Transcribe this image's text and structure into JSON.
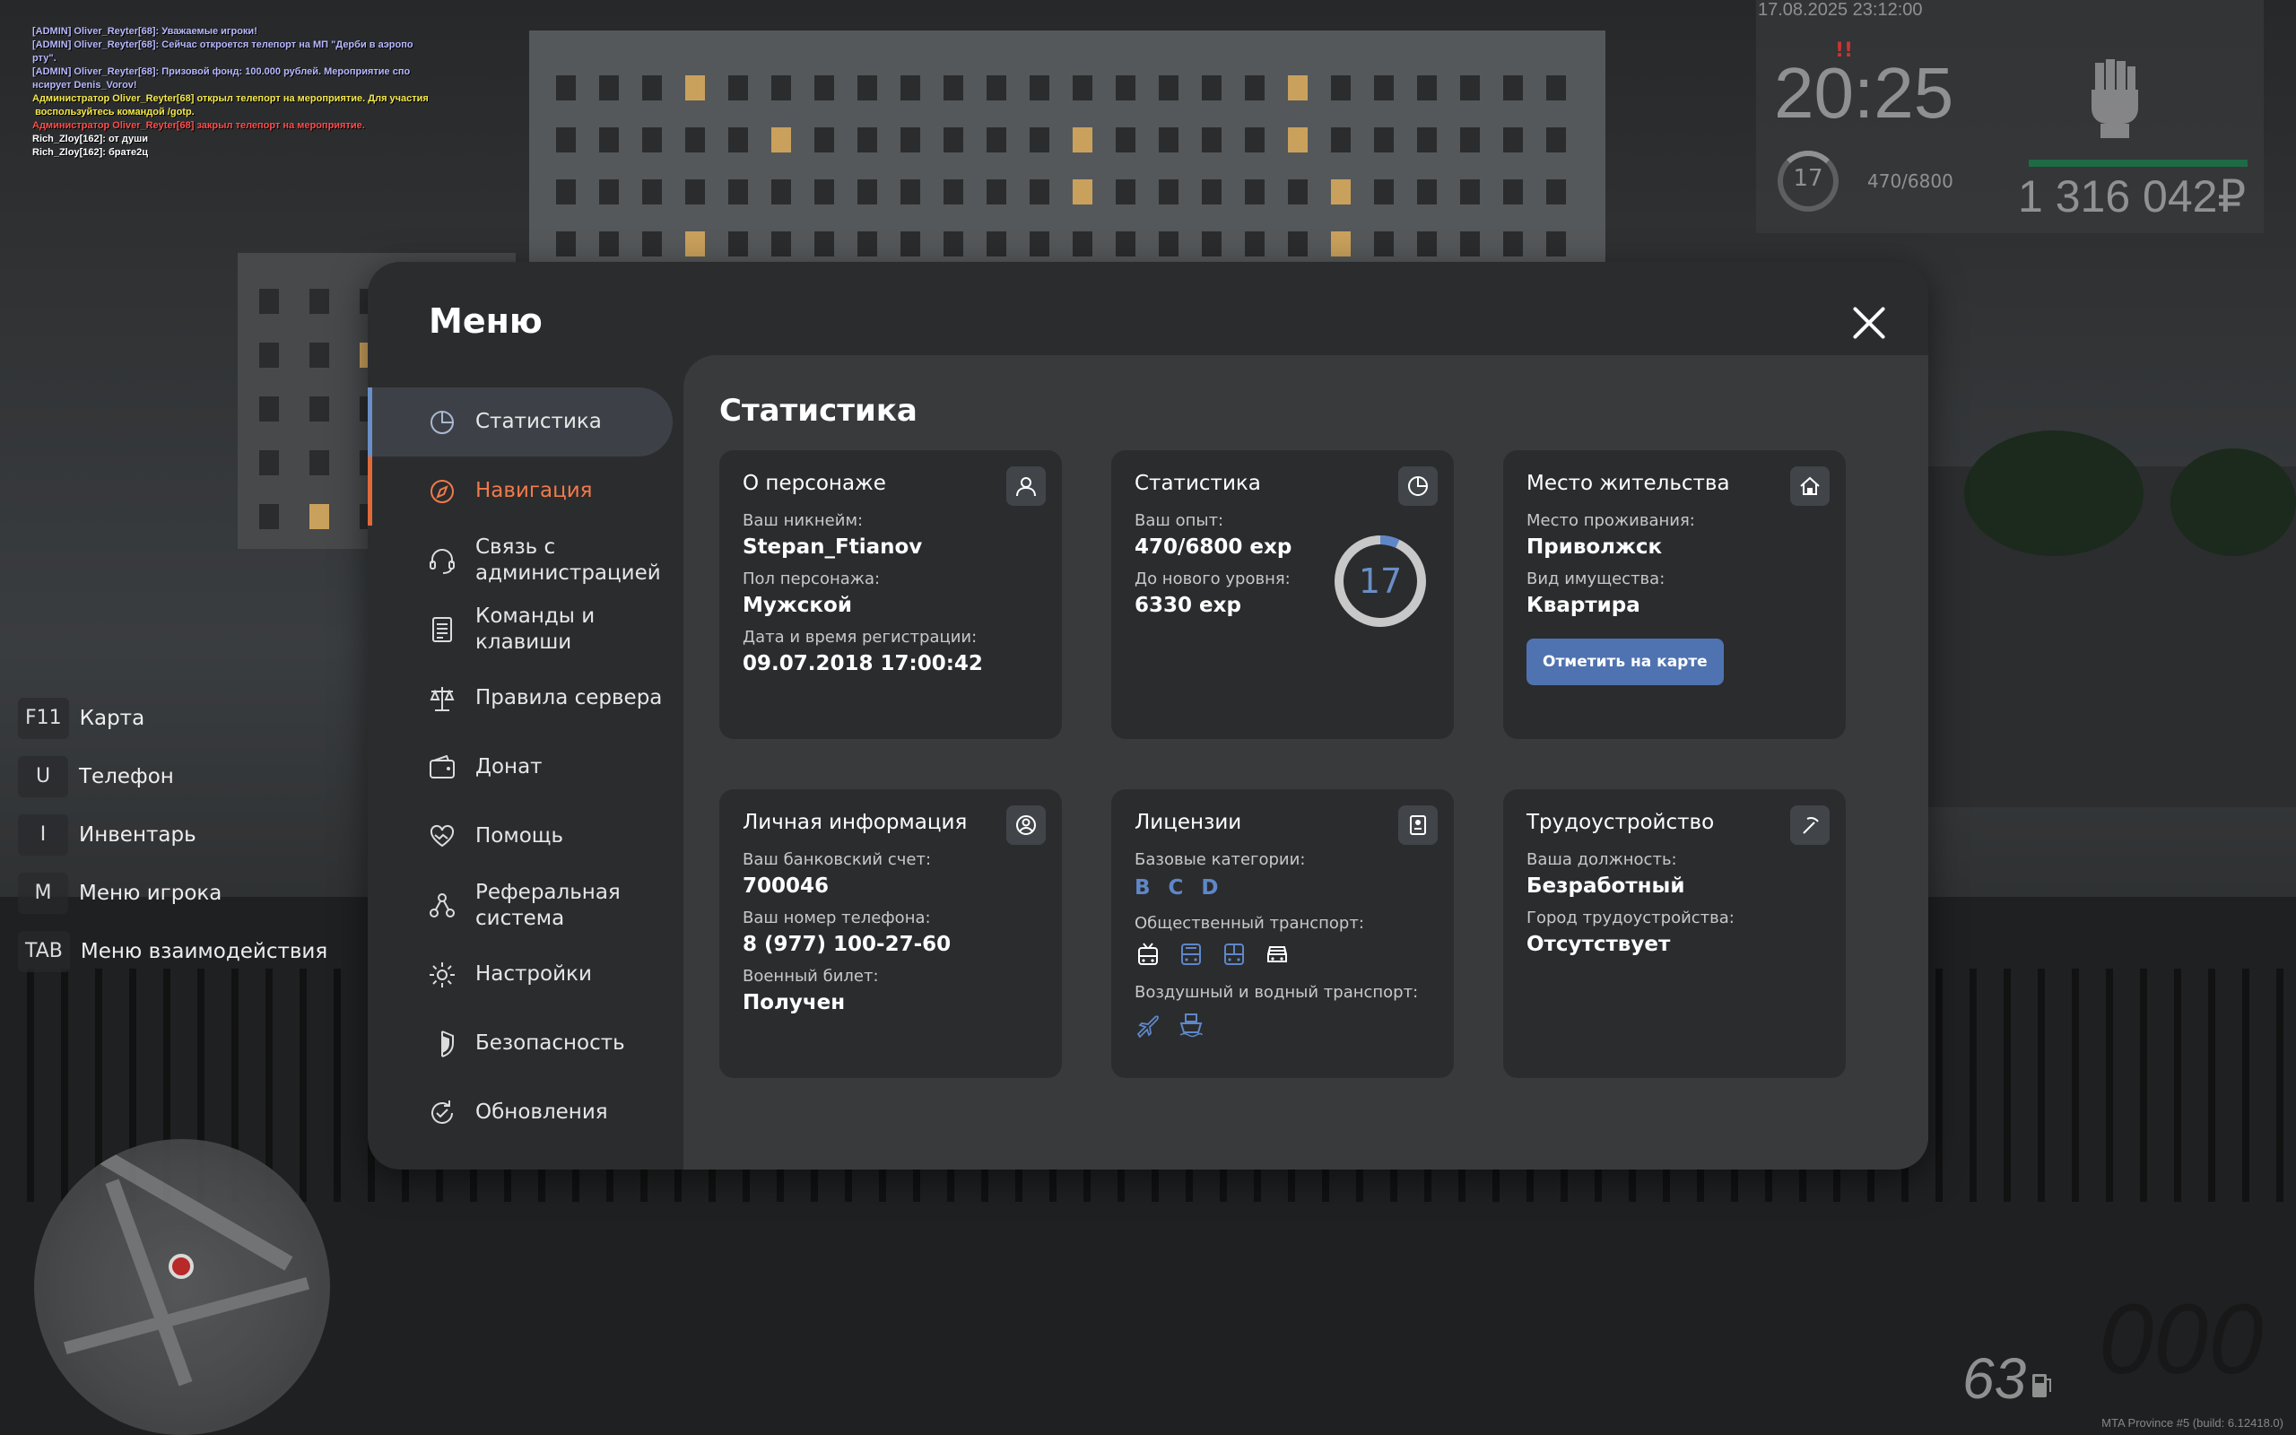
{
  "chat": [
    {
      "text": "[ADMIN] Oliver_Reyter[68]: Уважаемые игроки!",
      "color": "#b8b8ff"
    },
    {
      "text": "[ADMIN] Oliver_Reyter[68]: Сейчас откроется телепорт на МП \"Дерби в аэропо\nрту\".",
      "color": "#b8b8ff"
    },
    {
      "text": "[ADMIN] Oliver_Reyter[68]: Призовой фонд: 100.000 рублей. Мероприятие спо\nнсирует Denis_Vorov!",
      "color": "#b8b8ff"
    },
    {
      "text": "Администратор Oliver_Reyter[68] открыл телепорт на мероприятие. Для участия\n воспользуйтесь командой /gotp.",
      "color": "#f5e84a"
    },
    {
      "text": "Администратор Oliver_Reyter[68] закрыл телепорт на мероприятие.",
      "color": "#ff4d4d"
    },
    {
      "text": "Rich_Zloy[162]: от души",
      "color": "#ffffff"
    },
    {
      "text": "Rich_Zloy[162]: брате2ц",
      "color": "#ffffff"
    }
  ],
  "hud": {
    "datetime": "17.08.2025 23:12:00",
    "time": "20:25",
    "alarm": "!!",
    "level": "17",
    "exp": "470/6800",
    "money": "1 316 042₽"
  },
  "hotkeys": [
    {
      "key": "F11",
      "label": "Карта"
    },
    {
      "key": "U",
      "label": "Телефон"
    },
    {
      "key": "I",
      "label": "Инвентарь"
    },
    {
      "key": "M",
      "label": "Меню игрока"
    },
    {
      "key": "TAB",
      "label": "Меню взаимодействия"
    }
  ],
  "vehicle": {
    "speed": "63",
    "big": "000"
  },
  "build": "MTA Province #5 (build: 6.12418.0)",
  "menu": {
    "title": "Меню",
    "nav": [
      {
        "label": "Статистика",
        "icon": "pie-chart-icon"
      },
      {
        "label": "Навигация",
        "icon": "compass-icon"
      },
      {
        "label": "Связь с\nадминистрацией",
        "icon": "headset-icon"
      },
      {
        "label": "Команды и\nклавиши",
        "icon": "document-list-icon"
      },
      {
        "label": "Правила сервера",
        "icon": "scales-icon"
      },
      {
        "label": "Донат",
        "icon": "wallet-icon"
      },
      {
        "label": "Помощь",
        "icon": "heart-hands-icon"
      },
      {
        "label": "Реферальная\nсистема",
        "icon": "referral-icon"
      },
      {
        "label": "Настройки",
        "icon": "gear-icon"
      },
      {
        "label": "Безопасность",
        "icon": "shield-icon"
      },
      {
        "label": "Обновления",
        "icon": "refresh-check-icon"
      }
    ],
    "active_index": 0,
    "hover_index": 1
  },
  "stats": {
    "title": "Статистика",
    "character": {
      "title": "О персонаже",
      "nickname_label": "Ваш никнейм:",
      "nickname": "Stepan_Ftianov",
      "gender_label": "Пол персонажа:",
      "gender": "Мужской",
      "reg_label": "Дата и время регистрации:",
      "reg": "09.07.2018 17:00:42"
    },
    "experience": {
      "title": "Статистика",
      "exp_label": "Ваш опыт:",
      "exp": "470/6800 exp",
      "next_label": "До нового уровня:",
      "next": "6330 exp",
      "level": "17",
      "progress": 0.069
    },
    "residence": {
      "title": "Место жительства",
      "place_label": "Место проживания:",
      "place": "Приволжск",
      "property_label": "Вид имущества:",
      "property": "Квартира",
      "button": "Отметить на карте"
    },
    "personal": {
      "title": "Личная информация",
      "bank_label": "Ваш банковский счет:",
      "bank": "700046",
      "phone_label": "Ваш номер телефона:",
      "phone": "8 (977) 100-27-60",
      "military_label": "Военный билет:",
      "military": "Получен"
    },
    "licenses": {
      "title": "Лицензии",
      "base_label": "Базовые категории:",
      "base": "B C D",
      "public_label": "Общественный транспорт:",
      "public_icons": [
        "trolleybus-icon",
        "bus-icon",
        "tram-icon",
        "taxi-icon"
      ],
      "air_label": "Воздушный и водный транспорт:",
      "air_icons": [
        "plane-icon",
        "boat-icon"
      ]
    },
    "job": {
      "title": "Трудоустройство",
      "position_label": "Ваша должность:",
      "position": "Безработный",
      "city_label": "Город трудоустройства:",
      "city": "Отсутствует"
    }
  },
  "colors": {
    "accent": "#4f73b0",
    "hover": "#e06a3a",
    "money_bar": "#1e6a45"
  }
}
